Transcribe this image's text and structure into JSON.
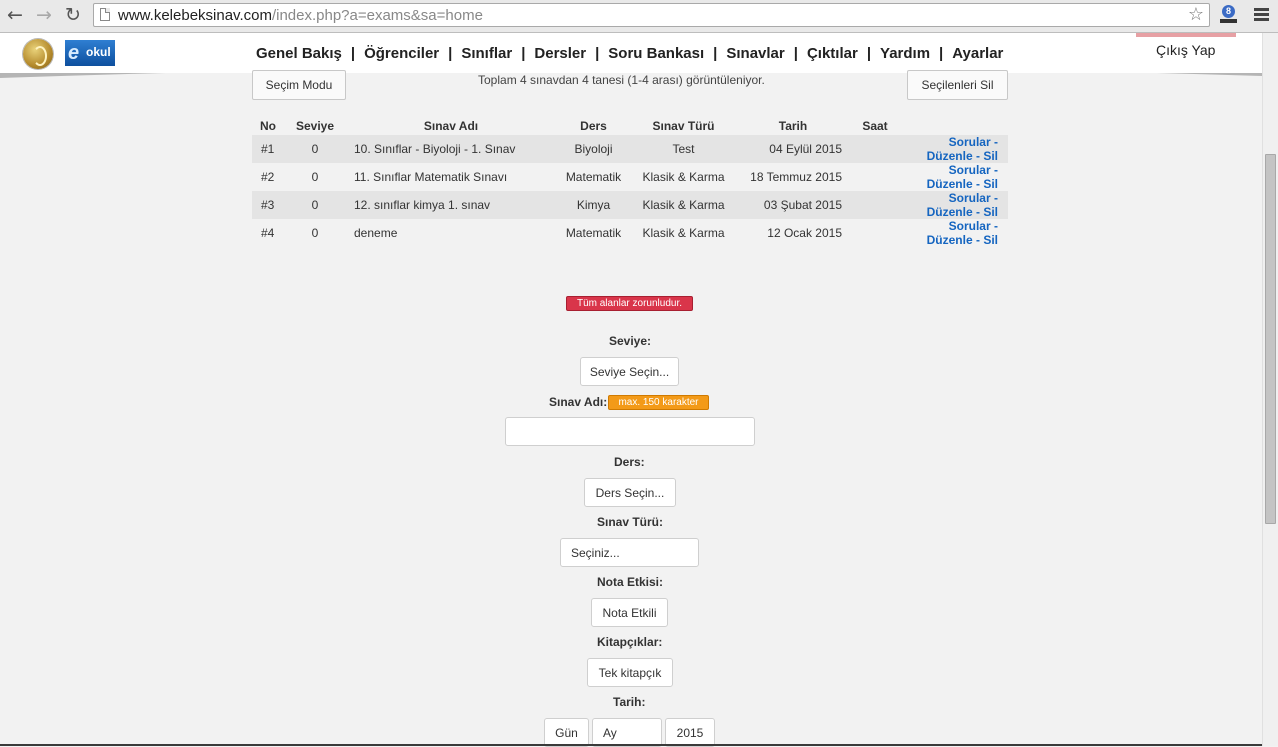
{
  "browser": {
    "url_host": "www.kelebeksinav.com",
    "url_path": "/index.php?a=exams&sa=home"
  },
  "header": {
    "logo_text": "okul",
    "nav": [
      "Genel Bakış",
      "Öğrenciler",
      "Sınıflar",
      "Dersler",
      "Soru Bankası",
      "Sınavlar",
      "Çıktılar",
      "Yardım",
      "Ayarlar"
    ],
    "logout": "Çıkış Yap"
  },
  "toolbar": {
    "select_mode": "Seçim Modu",
    "summary": "Toplam 4 sınavdan 4 tanesi (1-4 arası) görüntüleniyor.",
    "delete_selected": "Seçilenleri Sil"
  },
  "table": {
    "columns": [
      "No",
      "Seviye",
      "Sınav Adı",
      "Ders",
      "Sınav Türü",
      "Tarih",
      "Saat"
    ],
    "rows": [
      {
        "no": "#1",
        "level": "0",
        "name": "10. Sınıflar - Biyoloji - 1. Sınav",
        "course": "Biyoloji",
        "type": "Test",
        "date": "04 Eylül 2015",
        "time": ""
      },
      {
        "no": "#2",
        "level": "0",
        "name": "11. Sınıflar Matematik Sınavı",
        "course": "Matematik",
        "type": "Klasik & Karma",
        "date": "18 Temmuz 2015",
        "time": ""
      },
      {
        "no": "#3",
        "level": "0",
        "name": "12. sınıflar kimya 1. sınav",
        "course": "Kimya",
        "type": "Klasik & Karma",
        "date": "03 Şubat 2015",
        "time": ""
      },
      {
        "no": "#4",
        "level": "0",
        "name": "deneme",
        "course": "Matematik",
        "type": "Klasik & Karma",
        "date": "12 Ocak 2015",
        "time": ""
      }
    ],
    "actions": {
      "questions": "Sorular",
      "edit": "Düzenle",
      "delete": "Sil",
      "separator": " - "
    }
  },
  "form": {
    "required_notice": "Tüm alanlar zorunludur.",
    "level_label": "Seviye:",
    "level_value": "Seviye Seçin...",
    "name_label": "Sınav Adı:",
    "name_hint": "max. 150 karakter",
    "name_value": "",
    "course_label": "Ders:",
    "course_value": "Ders Seçin...",
    "type_label": "Sınav Türü:",
    "type_value": "Seçiniz...",
    "grade_label": "Nota Etkisi:",
    "grade_value": "Nota Etkili",
    "booklet_label": "Kitapçıklar:",
    "booklet_value": "Tek kitapçık",
    "date_label": "Tarih:",
    "day_value": "Gün",
    "month_value": "Ay",
    "year_value": "2015"
  }
}
